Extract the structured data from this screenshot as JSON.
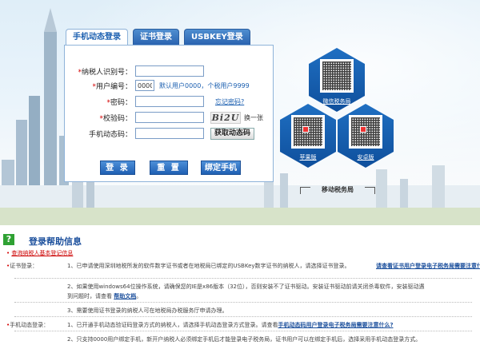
{
  "tabs": [
    {
      "label": "手机动态登录",
      "active": true
    },
    {
      "label": "证书登录",
      "active": false
    },
    {
      "label": "USBKEY登录",
      "active": false
    }
  ],
  "form": {
    "taxpayer_id_label": "纳税人识别号：",
    "taxpayer_id_value": "",
    "user_no_label": "用户编号：",
    "user_no_value": "0000",
    "user_no_hint": "默认用户0000，个税用户9999",
    "password_label": "密码：",
    "forgot_password": "忘记密码?",
    "captcha_label": "校验码：",
    "captcha_text": "Bi2U",
    "captcha_refresh": "换一张",
    "sms_code_label": "手机动态码：",
    "get_sms_button": "获取动态码",
    "required_mark": "*"
  },
  "buttons": {
    "login": "登 录",
    "reset": "重 置",
    "bind_phone": "绑定手机"
  },
  "qr": {
    "wechat_label": "微信税务局",
    "android_label": "安卓版",
    "apple_label": "苹果版",
    "mobile_bureau": "移动税务局"
  },
  "help": {
    "title": "登录帮助信息",
    "line0_link": "查询纳税人基本登记信息",
    "line1_label": "证书登录：",
    "line1_text": "1、已申请使用深圳地税所发的软件数字证书或者在地税局已绑定的USBKey数字证书的纳税人，请选择证书登录。",
    "line1_link": "请查看证书用户登录电子税务局需要注意什么?",
    "line2_text": "2、如果使用windows64位操作系统，请确保您的IE是x86版本（32位），否则安装不了证书驱动。安装证书驱动前请关闭杀毒软件，安装驱动遇",
    "line2b_text": "到问题时，请查看",
    "line2b_link": "帮助文档",
    "line2b_tail": "。",
    "line3_text": "3、需要使用证书登录的纳税人可在地税局办税服务厅申请办理。",
    "line4_label": "手机动态登录：",
    "line4_text": "1、已开通手机动态验证码登录方式的纳税人，请选择手机动态登录方式登录。请查看",
    "line4_link": "手机动态码用户登录电子税务局需要注意什么?",
    "line5_text": "2、只支持0000用户绑定手机，新开户纳税人必须绑定手机后才能登录电子税务局，证书用户可以在绑定手机后，选择采用手机动态登录方式。",
    "bullet": "•"
  },
  "colors": {
    "accent_blue": "#1b5fb0",
    "required_red": "#d40000",
    "help_icon_green": "#2fa133"
  }
}
